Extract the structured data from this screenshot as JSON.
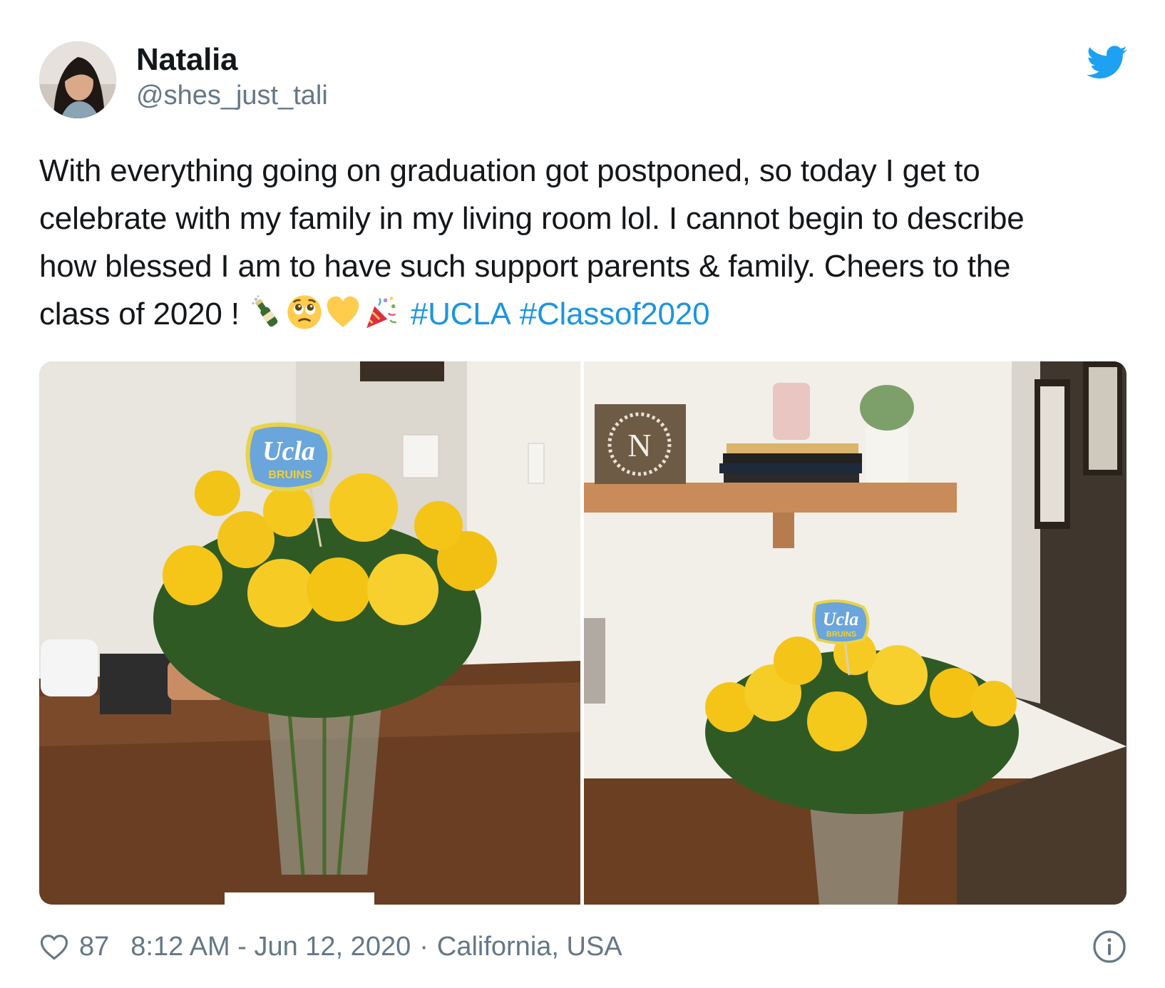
{
  "author": {
    "name": "Natalia",
    "handle": "@shes_just_tali"
  },
  "icons": {
    "brand": "twitter-bird-icon",
    "like": "heart-outline-icon",
    "info": "info-circle-icon",
    "emojis": [
      "champagne-emoji",
      "pleading-face-emoji",
      "yellow-heart-emoji",
      "party-popper-emoji"
    ]
  },
  "tweet": {
    "text_line1": "With everything going on graduation got postponed, so today I get to",
    "text_line2": "celebrate with my family in my living room lol. I cannot begin to describe",
    "text_line3": "how blessed I am to have such support parents & family. Cheers to the",
    "text_line4": "class of 2020 !",
    "hashtags": [
      "#UCLA",
      "#Classof2020"
    ]
  },
  "media": {
    "photo1_sign_top": "Ucla",
    "photo1_sign_bottom": "BRUINS",
    "photo2_sign_top": "Ucla",
    "photo2_sign_bottom": "BRUINS",
    "photo2_monogram": "N"
  },
  "footer": {
    "likes": "87",
    "timestamp": "8:12 AM - Jun 12, 2020",
    "separator": "·",
    "location": "California, USA"
  },
  "colors": {
    "link": "#1b95e0",
    "secondary_text": "#657786",
    "primary_text": "#14171a",
    "twitter_blue": "#1da1f2"
  }
}
